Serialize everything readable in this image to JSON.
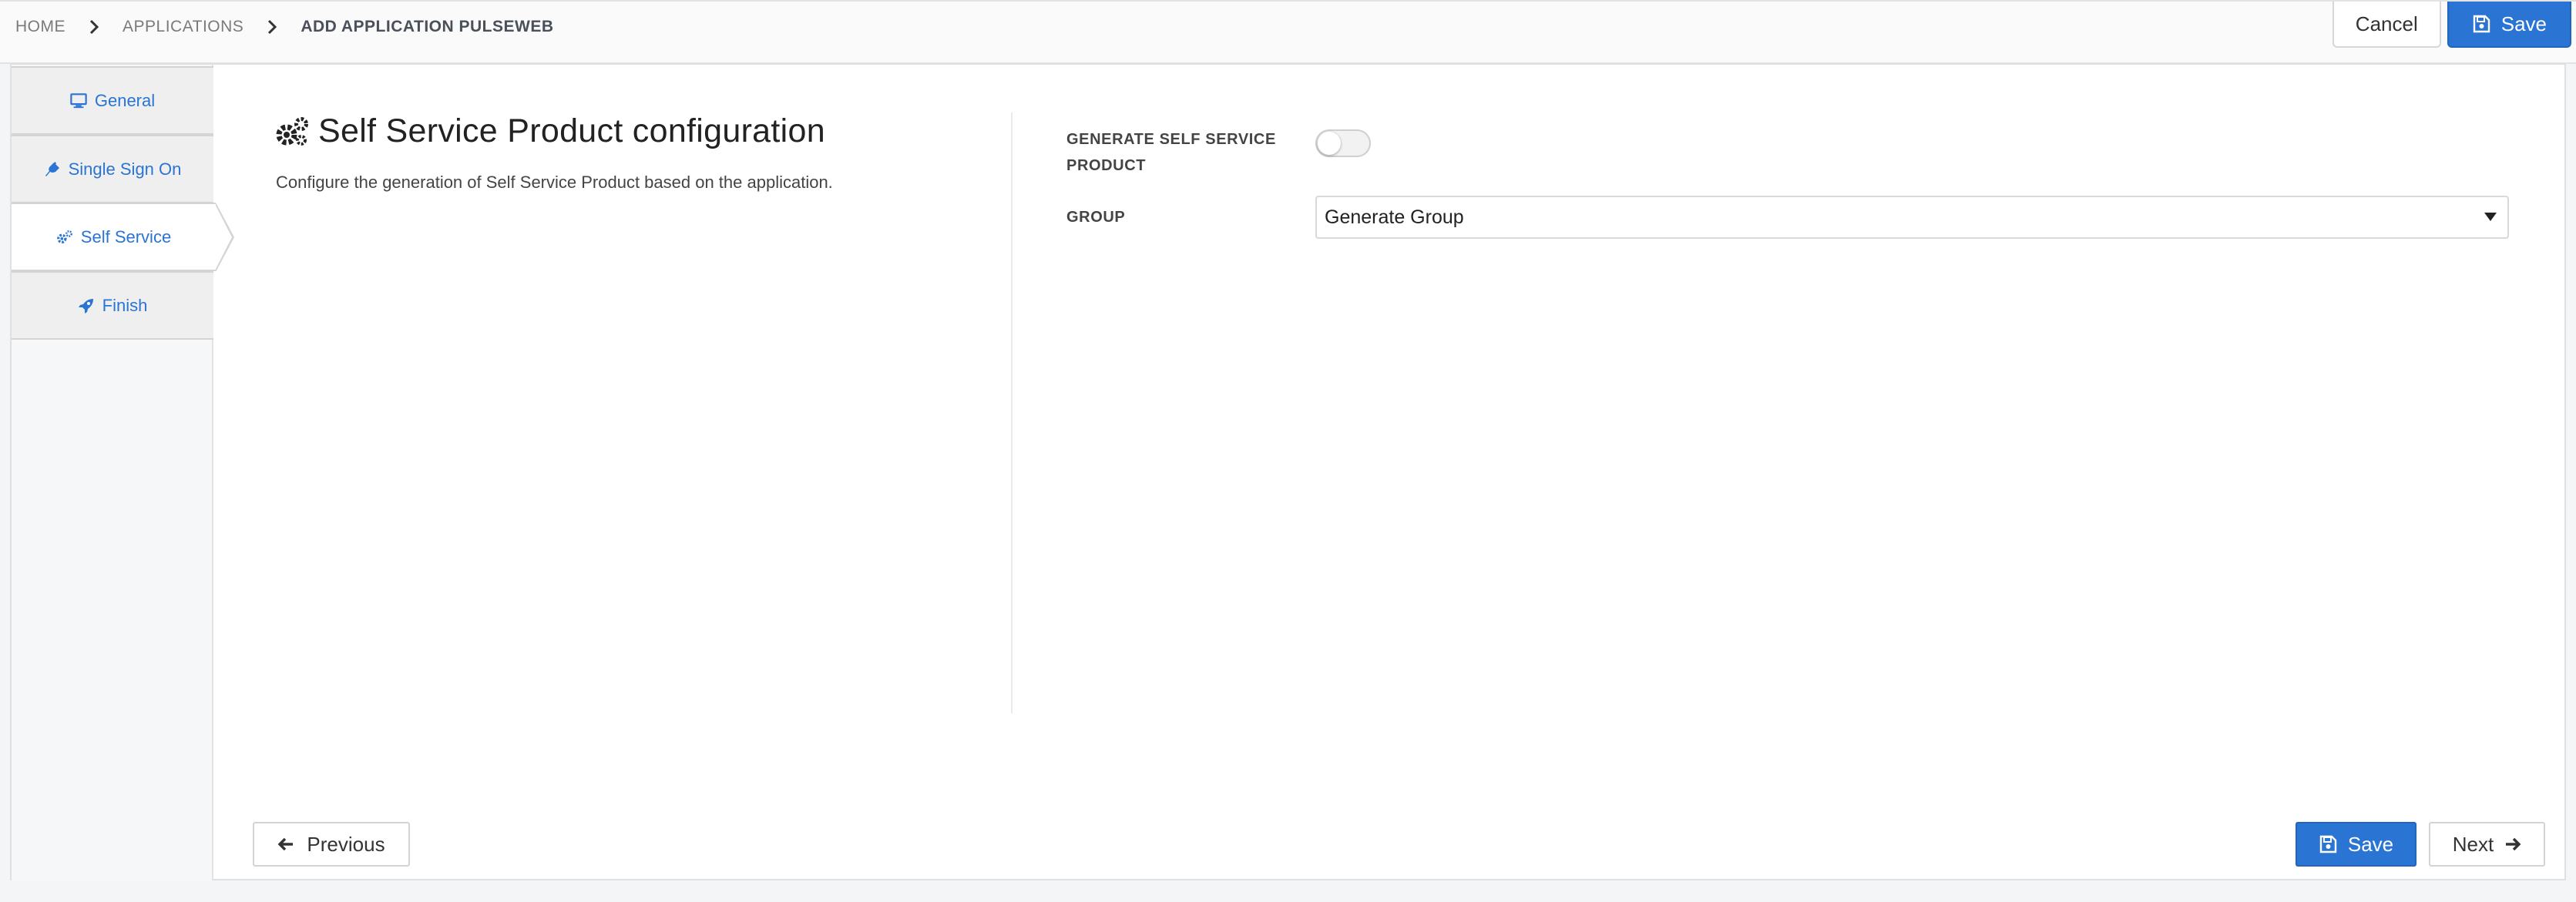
{
  "breadcrumb": {
    "items": [
      "HOME",
      "APPLICATIONS",
      "ADD APPLICATION PULSEWEB"
    ]
  },
  "header_actions": {
    "cancel_label": "Cancel",
    "save_label": "Save"
  },
  "sidebar": {
    "tabs": [
      {
        "label": "General",
        "icon": "monitor-icon",
        "active": false
      },
      {
        "label": "Single Sign On",
        "icon": "plug-icon",
        "active": false
      },
      {
        "label": "Self Service",
        "icon": "cogs-icon",
        "active": true
      },
      {
        "label": "Finish",
        "icon": "rocket-icon",
        "active": false
      }
    ]
  },
  "section": {
    "title": "Self Service Product configuration",
    "description": "Configure the generation of Self Service Product based on the application.",
    "icon": "cogs-icon"
  },
  "form": {
    "generate_label_line1": "GENERATE SELF SERVICE",
    "generate_label_line2": "PRODUCT",
    "generate_enabled": false,
    "group_label": "GROUP",
    "group_value": "Generate Group"
  },
  "footer": {
    "previous_label": "Previous",
    "save_label": "Save",
    "next_label": "Next"
  },
  "colors": {
    "accent": "#2a74d4",
    "background": "#f4f5f6"
  }
}
